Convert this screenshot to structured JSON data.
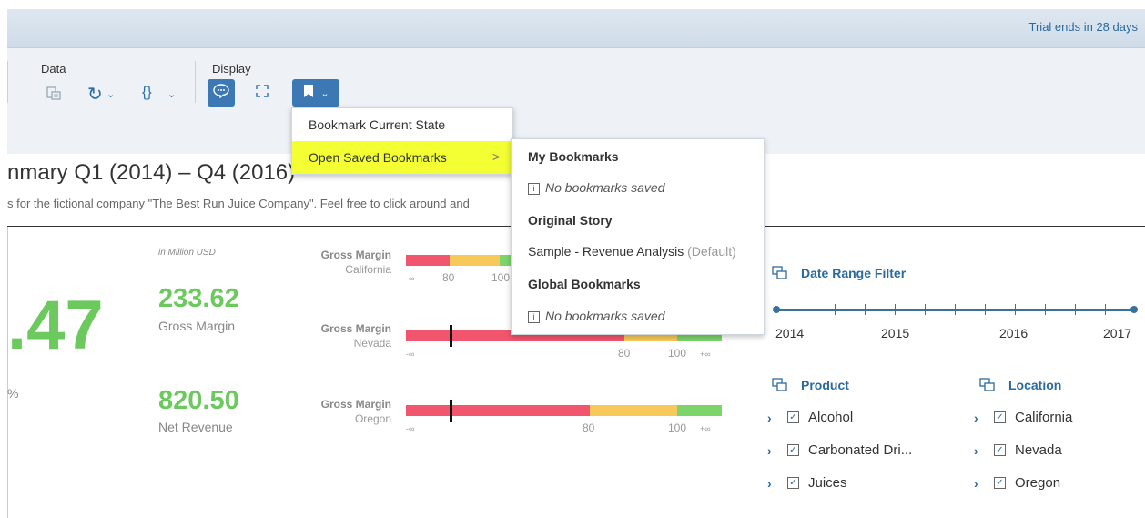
{
  "shell": {
    "trial_text": "Trial ends in 28 days"
  },
  "toolbar": {
    "data_label": "Data",
    "display_label": "Display",
    "icons": [
      "data-source-icon",
      "refresh-icon",
      "formula-icon",
      "comment-icon",
      "fullscreen-icon",
      "bookmark-icon"
    ]
  },
  "menu": {
    "bookmark_current": "Bookmark Current State",
    "open_saved": "Open Saved Bookmarks",
    "chevron": ">"
  },
  "submenu": {
    "my_bookmarks": "My Bookmarks",
    "my_empty": "No bookmarks saved",
    "original_story": "Original Story",
    "sample_item": "Sample - Revenue Analysis",
    "sample_default": "(Default)",
    "global_bookmarks": "Global Bookmarks",
    "global_empty": "No bookmarks saved"
  },
  "story": {
    "title": "nmary Q1 (2014) – Q4 (2016)",
    "subtitle": "s for the fictional company \"The Best Run Juice Company\". Feel free to click around and"
  },
  "kpis": {
    "unit": "in Million USD",
    "big_value": ".47",
    "pct_frag": "%",
    "gross_margin_value": "233.62",
    "gross_margin_label": "Gross Margin",
    "net_revenue_value": "820.50",
    "net_revenue_label": "Net Revenue"
  },
  "bullet_charts": [
    {
      "title": "Gross Margin",
      "region": "California",
      "ticks": [
        "-∞",
        "80",
        "100"
      ]
    },
    {
      "title": "Gross Margin",
      "region": "Nevada",
      "ticks": [
        "-∞",
        "80",
        "100",
        "+∞"
      ]
    },
    {
      "title": "Gross Margin",
      "region": "Oregon",
      "ticks": [
        "-∞",
        "80",
        "100",
        "+∞"
      ]
    }
  ],
  "filters": {
    "date_title": "Date Range Filter",
    "years": [
      "2014",
      "2015",
      "2016",
      "2017"
    ],
    "product_title": "Product",
    "products": [
      "Alcohol",
      "Carbonated Dri...",
      "Juices"
    ],
    "location_title": "Location",
    "locations": [
      "California",
      "Nevada",
      "Oregon"
    ],
    "check": "✓"
  },
  "colors": {
    "accent": "#3c78b4",
    "kpi_green": "#6cc95e",
    "bar_red": "#f2566e",
    "bar_yellow": "#f7c95a",
    "bar_green": "#7cd46a",
    "highlight": "#f3ff33"
  }
}
